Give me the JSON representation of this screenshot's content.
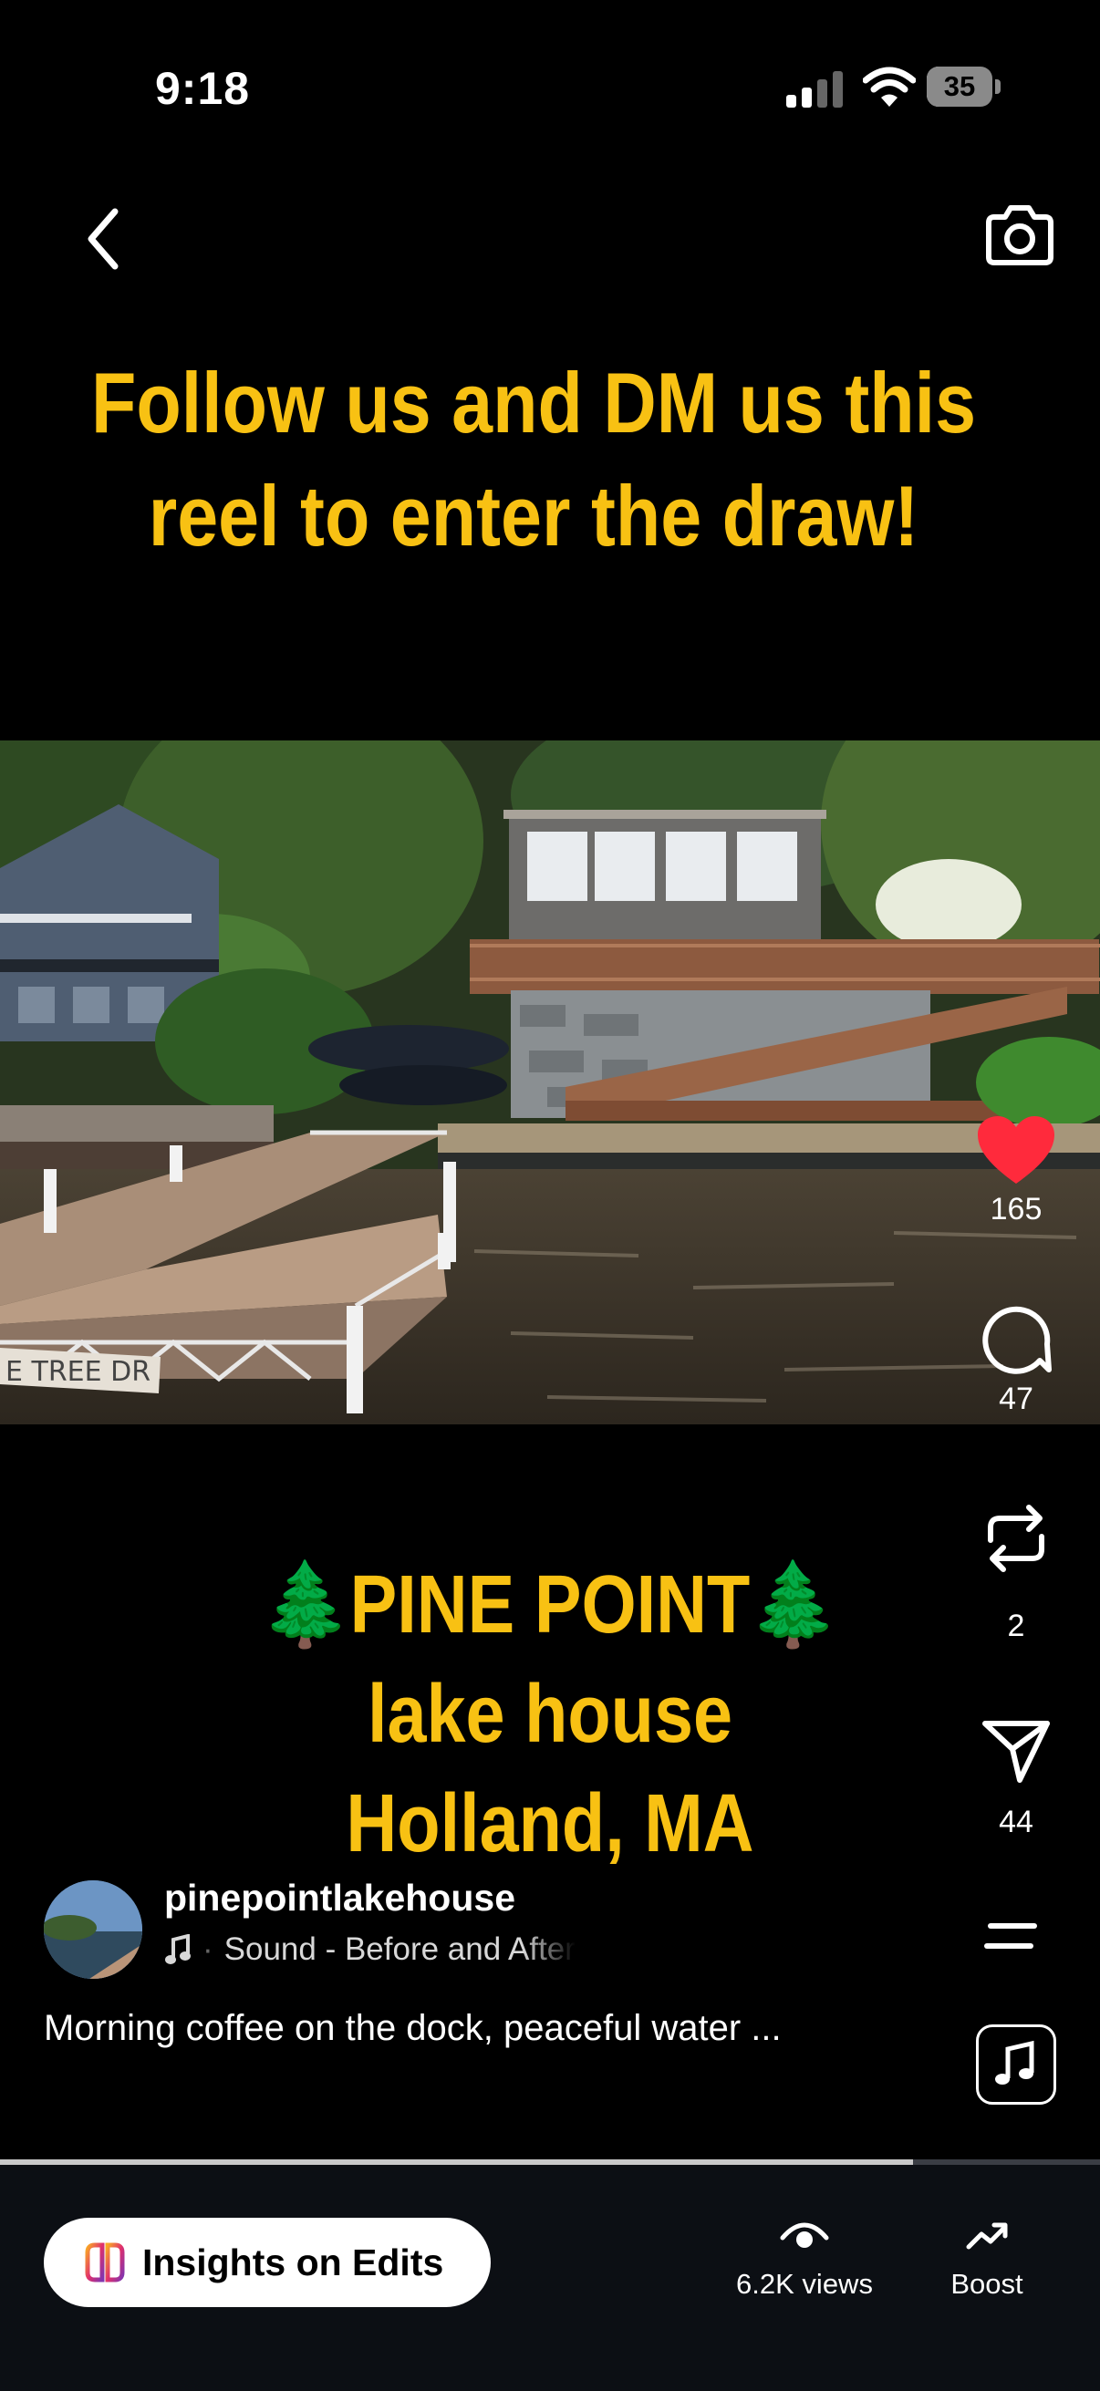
{
  "status_bar": {
    "time": "9:18",
    "battery": "35"
  },
  "overlay": {
    "top_caption": [
      "Follow us and DM us this",
      "reel to enter the draw!"
    ],
    "bottom_caption": [
      "🌲PINE POINT🌲",
      "lake house",
      "Holland, MA"
    ],
    "dock_sign": "E TREE DR"
  },
  "actions": {
    "like_count": "165",
    "comment_count": "47",
    "repost_count": "2",
    "share_count": "44"
  },
  "author": {
    "username": "pinepointlakehouse"
  },
  "music": {
    "label": "Sound - Before and After"
  },
  "description": "Morning coffee on the dock, peaceful water ...",
  "progress": {
    "fraction": 0.83
  },
  "bottom_bar": {
    "insights_label": "Insights on Edits",
    "views_label": "6.2K views",
    "boost_label": "Boost"
  },
  "colors": {
    "like": "#ff2a3c",
    "caption": "#f8c113",
    "bar": "#0c0f14"
  },
  "icons": [
    "back-icon",
    "camera-icon",
    "heart-icon",
    "comment-icon",
    "repost-icon",
    "share-icon",
    "more-icon",
    "music-note-icon",
    "eye-icon",
    "trend-up-icon",
    "edits-logo-icon"
  ]
}
